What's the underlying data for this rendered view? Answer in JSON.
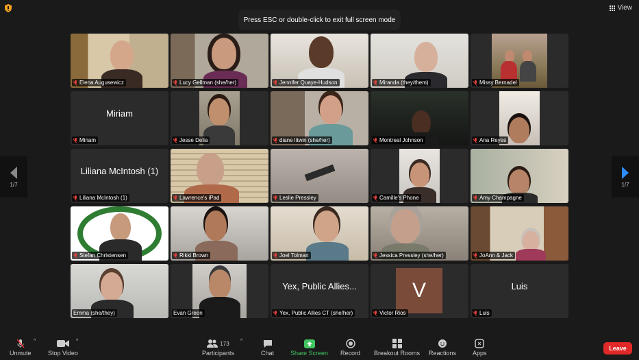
{
  "banner": {
    "text": "Press ESC or double-click to exit full screen mode"
  },
  "view": {
    "label": "View"
  },
  "pager": {
    "left": "1/7",
    "right": "1/7"
  },
  "participants": [
    {
      "name": "Elena Augusewicz"
    },
    {
      "name": "Lucy Gellman (she/her)"
    },
    {
      "name": "Jennifer Quaye-Hudson"
    },
    {
      "name": "Miranda  (they/them)"
    },
    {
      "name": "Missy Bernadel"
    },
    {
      "name": "Miriam",
      "display": "Miriam"
    },
    {
      "name": "Jesse Delia"
    },
    {
      "name": "diane litwin (she/her)"
    },
    {
      "name": "Montreal Johnson"
    },
    {
      "name": "Ana Reyes"
    },
    {
      "name": "Liliana McIntosh (1)",
      "display": "Liliana McIntosh (1)"
    },
    {
      "name": "Lawrence's iPad"
    },
    {
      "name": "Leslie Pressley"
    },
    {
      "name": "Camille's  Phone"
    },
    {
      "name": "Amy Champagne"
    },
    {
      "name": "Stefan Christensen"
    },
    {
      "name": "Rikki Brown"
    },
    {
      "name": "Joel Tolman"
    },
    {
      "name": "Jessica Pressley (she/her)"
    },
    {
      "name": "JoAnn & Jack"
    },
    {
      "name": "Emma (she/they)"
    },
    {
      "name": "Evan Green"
    },
    {
      "name": "Yex, Public Allies CT (she/her)",
      "display": "Yex, Public Allies..."
    },
    {
      "name": "Victor Rios",
      "avatar_letter": "V"
    },
    {
      "name": "Luis",
      "display": "Luis"
    }
  ],
  "toolbar": {
    "unmute": "Unmute",
    "stop_video": "Stop Video",
    "participants": "Participants",
    "participants_count": "173",
    "chat": "Chat",
    "share_screen": "Share Screen",
    "record": "Record",
    "breakout_rooms": "Breakout Rooms",
    "reactions": "Reactions",
    "apps": "Apps",
    "leave": "Leave"
  },
  "colors": {
    "share_green": "#43c463",
    "leave_red": "#e02828",
    "active_speaker": "#4caf50",
    "pager_arrow": "#2d8cff"
  }
}
